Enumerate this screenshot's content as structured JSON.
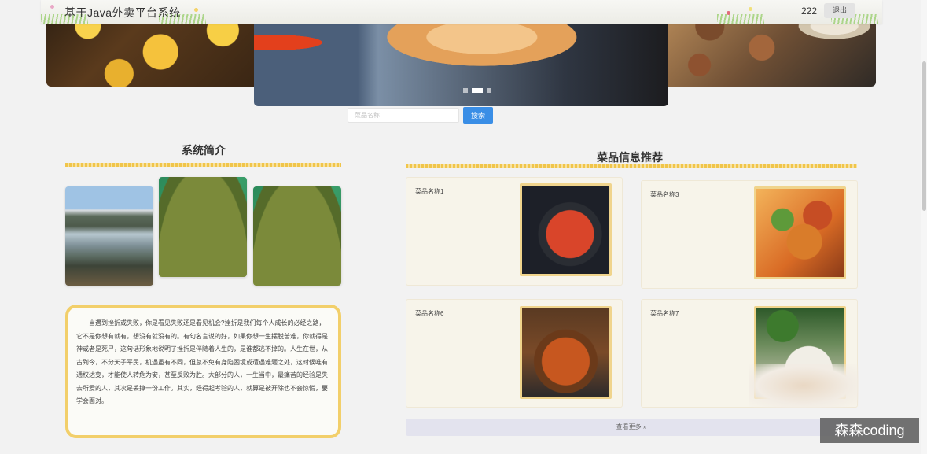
{
  "header": {
    "title": "基于Java外卖平台系统",
    "user": "222",
    "logout_label": "退出"
  },
  "search": {
    "placeholder": "菜品名称",
    "button_label": "搜索"
  },
  "carousel": {
    "slide_count": 3,
    "active_index": 1
  },
  "intro": {
    "title": "系统简介",
    "text": "当遇到挫折或失败，你是看见失败还是看见机会?挫折是我们每个人成长的必经之路，它不是你想有就有，想没有就没有的。有句名言说的好，如果你想一生摆脱苦难，你就得是神或者是死尸，这句话形象地说明了挫折是伴随着人生的，是谁都逃不掉的。人生在世，从古到今，不分天子平民，机遇虽有不同，但总不免有身陷困境或遭遇难题之处，这时候唯有通权达变，才能使人转危为安，甚至反败为胜。大部分的人，一生当中，最痛苦的经验是失去所爱的人，其次是丢掉一份工作。其实，经得起考验的人，就算是被开除也不会惊慌，要学会面对。"
  },
  "recommend": {
    "title": "菜品信息推荐",
    "items": [
      {
        "name": "菜品名称1"
      },
      {
        "name": "菜品名称3"
      },
      {
        "name": "菜品名称6"
      },
      {
        "name": "菜品名称7"
      }
    ],
    "more_label": "查看更多 »"
  },
  "watermark": "森森coding"
}
